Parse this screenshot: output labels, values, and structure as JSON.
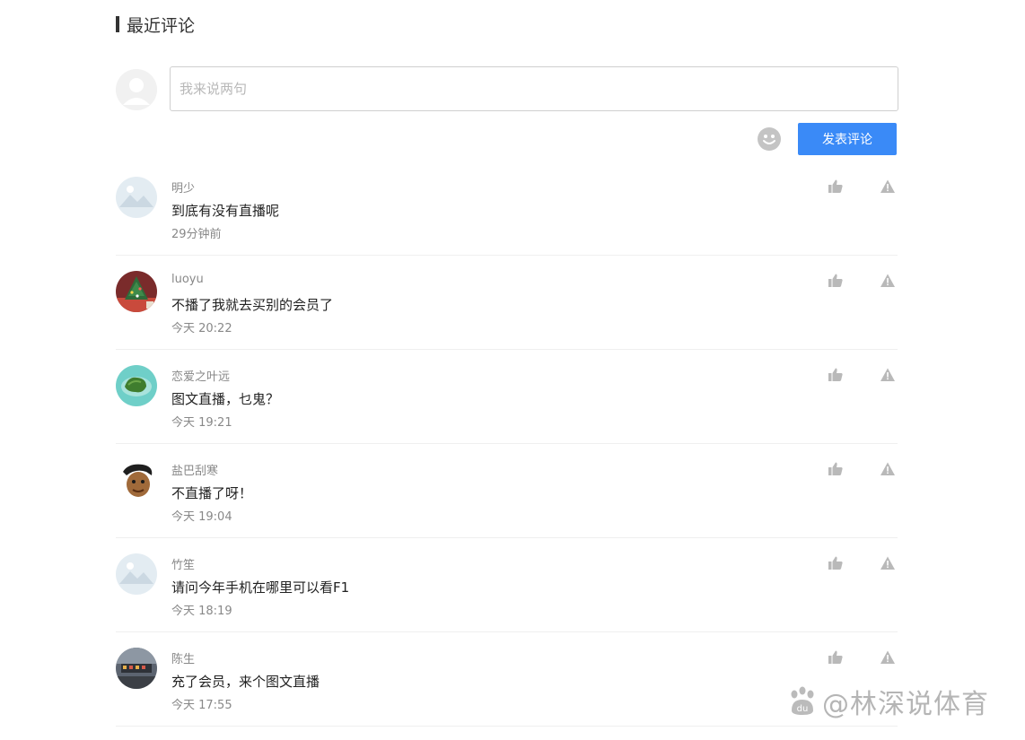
{
  "section": {
    "title": "最近评论"
  },
  "composer": {
    "placeholder": "我来说两句",
    "submit_label": "发表评论",
    "emoji_icon": "smiley-icon"
  },
  "colors": {
    "accent": "#3a8af7",
    "text_primary": "#222222",
    "text_secondary": "#888888",
    "divider": "#efefef",
    "icon_gray": "#b9b9b9"
  },
  "comments": [
    {
      "user": "明少",
      "content": "到底有没有直播呢",
      "time": "29分钟前",
      "avatar": "placeholder-mountain-avatar"
    },
    {
      "user": "luoyu",
      "content": "不播了我就去买别的会员了",
      "time": "今天 20:22",
      "avatar": "christmas-tree-avatar"
    },
    {
      "user": "恋爱之叶远",
      "content": "图文直播，乜鬼？",
      "time": "今天 19:21",
      "avatar": "island-avatar"
    },
    {
      "user": "盐巴刮寒",
      "content": "不直播了呀！",
      "time": "今天 19:04",
      "avatar": "cartoon-face-avatar"
    },
    {
      "user": "竹笙",
      "content": "请问今年手机在哪里可以看F1",
      "time": "今天 18:19",
      "avatar": "placeholder-mountain-avatar"
    },
    {
      "user": "陈生",
      "content": "充了会员，来个图文直播",
      "time": "今天 17:55",
      "avatar": "street-photo-avatar"
    }
  ],
  "watermark": {
    "text": "@林深说体育"
  }
}
